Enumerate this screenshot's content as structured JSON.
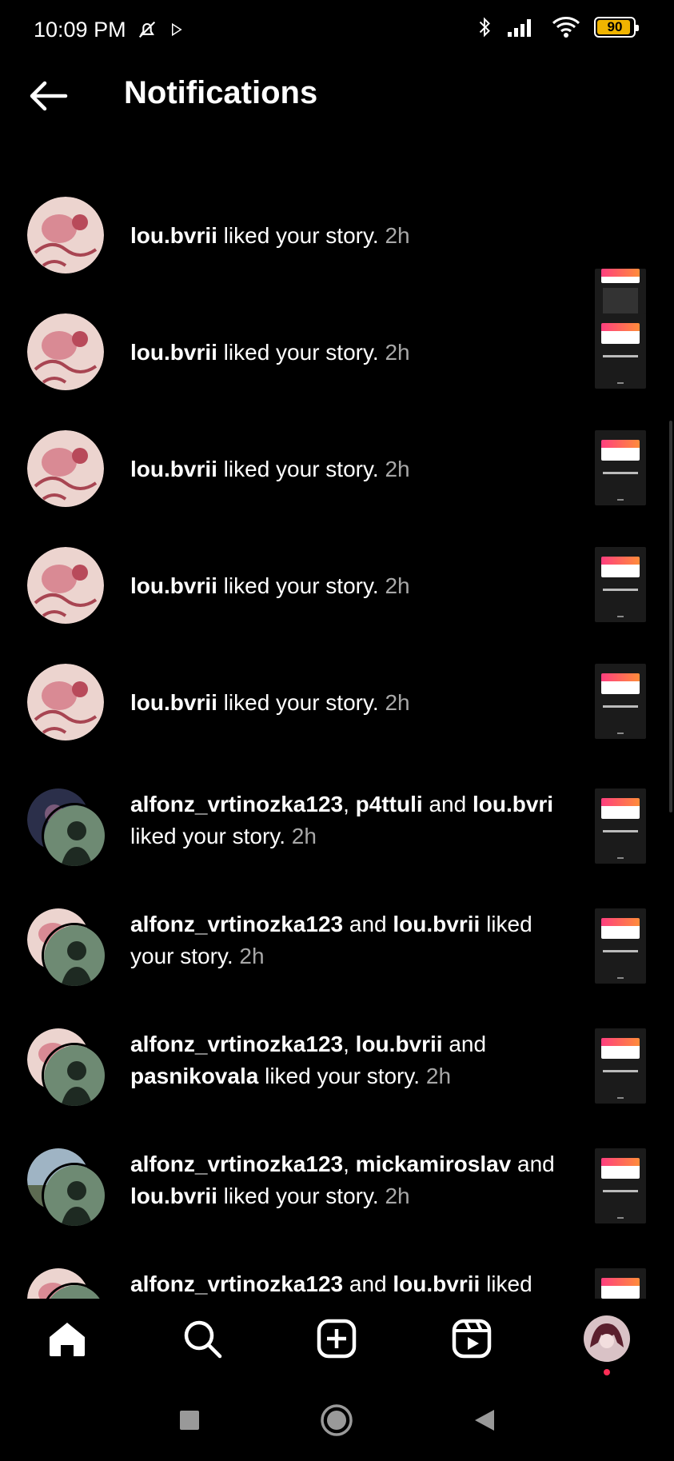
{
  "status_bar": {
    "time": "10:09 PM",
    "battery": "90",
    "icons": [
      "mute-bell-icon",
      "play-store-icon",
      "bluetooth-icon",
      "signal-icon",
      "wifi-icon",
      "battery-icon"
    ]
  },
  "header": {
    "title": "Notifications",
    "back_icon": "arrow-left-icon"
  },
  "notifications": [
    {
      "users": [
        "lou.bvrii"
      ],
      "line1": "",
      "text": " liked your story. ",
      "time": "2h"
    },
    {
      "users": [
        "lou.bvrii"
      ],
      "text": " liked your story. ",
      "time": "2h"
    },
    {
      "users": [
        "lou.bvrii"
      ],
      "text": " liked your story. ",
      "time": "2h"
    },
    {
      "users": [
        "lou.bvrii"
      ],
      "text": " liked your story. ",
      "time": "2h"
    },
    {
      "users": [
        "lou.bvrii"
      ],
      "text": " liked your story. ",
      "time": "2h"
    },
    {
      "users": [
        "alfonz_vrtinozka123",
        "p4ttuli",
        "lou.bvri"
      ],
      "sep1": ", ",
      "sep2": " and ",
      "text": " liked your story. ",
      "time": "2h"
    },
    {
      "users": [
        "alfonz_vrtinozka123",
        "lou.bvrii"
      ],
      "sep1": " and ",
      "text": " liked your story. ",
      "time": "2h"
    },
    {
      "users": [
        "alfonz_vrtinozka123",
        "lou.bvrii",
        "pasnikovala"
      ],
      "sep1": ", ",
      "sep2": " and ",
      "text": " liked your story. ",
      "time": "2h"
    },
    {
      "users": [
        "alfonz_vrtinozka123",
        "mickamiroslav",
        "lou.bvrii"
      ],
      "sep1": ", ",
      "sep2": " and ",
      "text": " liked your story. ",
      "time": "2h"
    },
    {
      "users": [
        "alfonz_vrtinozka123",
        "lou.bvrii"
      ],
      "sep1": " and ",
      "text": " liked",
      "time": ""
    }
  ],
  "bottom_nav": [
    "home-icon",
    "search-icon",
    "create-icon",
    "reels-icon",
    "profile-avatar"
  ],
  "system_nav": [
    "recents-square-icon",
    "home-circle-icon",
    "back-triangle-icon"
  ]
}
